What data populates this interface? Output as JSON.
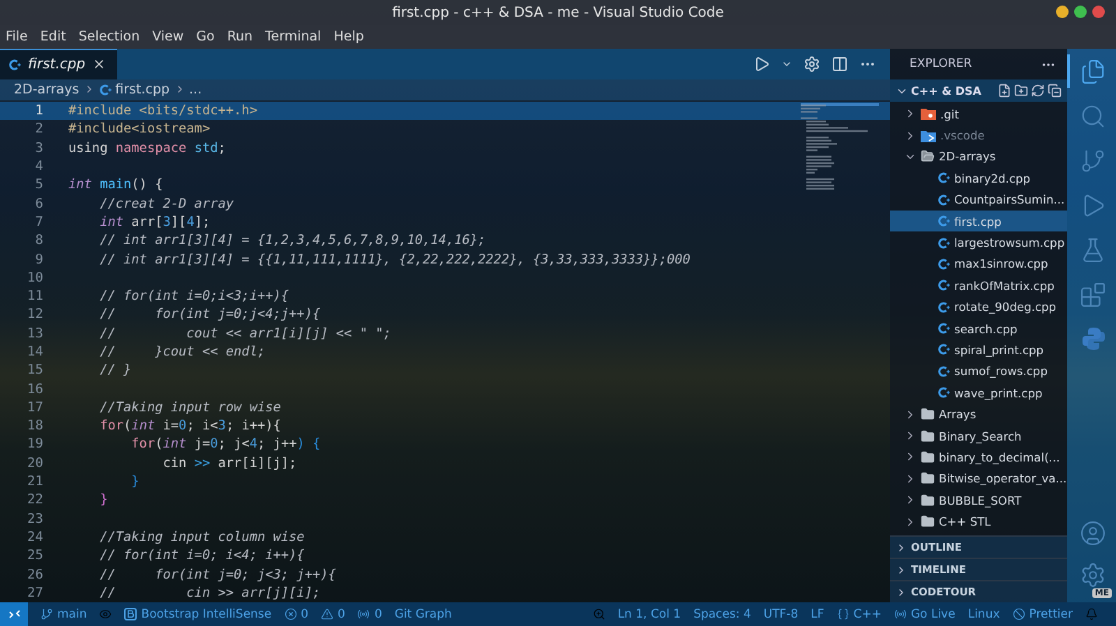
{
  "window": {
    "title": "first.cpp - c++ & DSA - me - Visual Studio Code"
  },
  "menu": [
    "File",
    "Edit",
    "Selection",
    "View",
    "Go",
    "Run",
    "Terminal",
    "Help"
  ],
  "tabs": [
    {
      "label": "first.cpp",
      "selected": true
    }
  ],
  "breadcrumbs": [
    "2D-arrays",
    "first.cpp",
    "..."
  ],
  "editor": {
    "lines": [
      {
        "number": "1",
        "current": true,
        "tokens": [
          {
            "kind": "pre",
            "t": "#include <bits/stdc++.h>"
          }
        ]
      },
      {
        "number": "2",
        "current": false,
        "tokens": [
          {
            "kind": "pre",
            "t": "#include<iostream>"
          }
        ]
      },
      {
        "number": "3",
        "current": false,
        "tokens": [
          {
            "kind": "plain",
            "t": "using "
          },
          {
            "kind": "kw",
            "t": "namespace "
          },
          {
            "kind": "ns",
            "t": "std"
          },
          {
            "kind": "plain",
            "t": ";"
          }
        ]
      },
      {
        "number": "4",
        "current": false
      },
      {
        "number": "5",
        "current": false,
        "tokens": [
          {
            "kind": "type",
            "t": "int "
          },
          {
            "kind": "fn",
            "t": "main"
          },
          {
            "kind": "plain",
            "t": "() {"
          }
        ]
      },
      {
        "number": "6",
        "current": false,
        "tokens": [
          {
            "kind": "com",
            "t": "    //creat 2-D array"
          }
        ]
      },
      {
        "number": "7",
        "current": false,
        "tokens": [
          {
            "kind": "type",
            "t": "    int"
          },
          {
            "kind": "plain",
            "t": " arr["
          },
          {
            "kind": "num",
            "t": "3"
          },
          {
            "kind": "plain",
            "t": "]["
          },
          {
            "kind": "num",
            "t": "4"
          },
          {
            "kind": "plain",
            "t": "];"
          }
        ]
      },
      {
        "number": "8",
        "current": false,
        "tokens": [
          {
            "kind": "com",
            "t": "    // int arr1[3][4] = {1,2,3,4,5,6,7,8,9,10,14,16};"
          }
        ]
      },
      {
        "number": "9",
        "current": false,
        "tokens": [
          {
            "kind": "com",
            "t": "    // int arr1[3][4] = {{1,11,111,1111}, {2,22,222,2222}, {3,33,333,3333}};000"
          }
        ]
      },
      {
        "number": "10",
        "current": false
      },
      {
        "number": "11",
        "current": false,
        "tokens": [
          {
            "kind": "com",
            "t": "    // for(int i=0;i<3;i++){"
          }
        ]
      },
      {
        "number": "12",
        "current": false,
        "tokens": [
          {
            "kind": "com",
            "t": "    //     for(int j=0;j<4;j++){"
          }
        ]
      },
      {
        "number": "13",
        "current": false,
        "tokens": [
          {
            "kind": "com",
            "t": "    //         cout << arr1[i][j] << \" \";"
          }
        ]
      },
      {
        "number": "14",
        "current": false,
        "tokens": [
          {
            "kind": "com",
            "t": "    //     }cout << endl;"
          }
        ]
      },
      {
        "number": "15",
        "current": false,
        "tokens": [
          {
            "kind": "com",
            "t": "    // }"
          }
        ]
      },
      {
        "number": "16",
        "current": false
      },
      {
        "number": "17",
        "current": false,
        "tokens": [
          {
            "kind": "com",
            "t": "    //Taking input row wise"
          }
        ]
      },
      {
        "number": "18",
        "current": false,
        "tokens": [
          {
            "kind": "kw",
            "t": "    for"
          },
          {
            "kind": "plain",
            "t": "("
          },
          {
            "kind": "type",
            "t": "int"
          },
          {
            "kind": "plain",
            "t": " i="
          },
          {
            "kind": "num",
            "t": "0"
          },
          {
            "kind": "plain",
            "t": "; i<"
          },
          {
            "kind": "num",
            "t": "3"
          },
          {
            "kind": "plain",
            "t": "; i++){"
          }
        ]
      },
      {
        "number": "19",
        "current": false,
        "tokens": [
          {
            "kind": "kw",
            "t": "        for"
          },
          {
            "kind": "plain",
            "t": "("
          },
          {
            "kind": "type",
            "t": "int"
          },
          {
            "kind": "plain",
            "t": " j="
          },
          {
            "kind": "num",
            "t": "0"
          },
          {
            "kind": "plain",
            "t": "; j<"
          },
          {
            "kind": "num",
            "t": "4"
          },
          {
            "kind": "plain",
            "t": "; j++"
          },
          {
            "kind": "brace",
            "t": ") {"
          }
        ]
      },
      {
        "number": "20",
        "current": false,
        "tokens": [
          {
            "kind": "plain",
            "t": "            cin "
          },
          {
            "kind": "op",
            "t": ">>"
          },
          {
            "kind": "plain",
            "t": " arr[i][j];"
          }
        ]
      },
      {
        "number": "21",
        "current": false,
        "tokens": [
          {
            "kind": "brace",
            "t": "        }"
          }
        ]
      },
      {
        "number": "22",
        "current": false,
        "tokens": [
          {
            "kind": "brace2",
            "t": "    }"
          }
        ]
      },
      {
        "number": "23",
        "current": false
      },
      {
        "number": "24",
        "current": false,
        "tokens": [
          {
            "kind": "com",
            "t": "    //Taking input column wise"
          }
        ]
      },
      {
        "number": "25",
        "current": false,
        "tokens": [
          {
            "kind": "com",
            "t": "    // for(int i=0; i<4; i++){"
          }
        ]
      },
      {
        "number": "26",
        "current": false,
        "tokens": [
          {
            "kind": "com",
            "t": "    //     for(int j=0; j<3; j++){"
          }
        ]
      },
      {
        "number": "27",
        "current": false,
        "tokens": [
          {
            "kind": "com",
            "t": "    //         cin >> arr[j][i];"
          }
        ]
      }
    ]
  },
  "explorer": {
    "title": "EXPLORER",
    "workspace": "C++ & DSA",
    "items": [
      {
        "name": ".git",
        "kind": "git",
        "expanded": false,
        "selected": false,
        "dimmed": false
      },
      {
        "name": ".vscode",
        "kind": "vscode",
        "expanded": false,
        "selected": false,
        "dimmed": true
      },
      {
        "name": "2D-arrays",
        "kind": "folder",
        "expanded": true,
        "selected": false,
        "dimmed": false,
        "children": [
          {
            "name": "binary2d.cpp",
            "kind": "cpp",
            "selected": false,
            "dimmed": false
          },
          {
            "name": "CountpairsSumin...",
            "kind": "cpp",
            "selected": false,
            "dimmed": false
          },
          {
            "name": "first.cpp",
            "kind": "cpp",
            "selected": true,
            "dimmed": false
          },
          {
            "name": "largestrowsum.cpp",
            "kind": "cpp",
            "selected": false,
            "dimmed": false
          },
          {
            "name": "max1sinrow.cpp",
            "kind": "cpp",
            "selected": false,
            "dimmed": false
          },
          {
            "name": "rankOfMatrix.cpp",
            "kind": "cpp",
            "selected": false,
            "dimmed": false
          },
          {
            "name": "rotate_90deg.cpp",
            "kind": "cpp",
            "selected": false,
            "dimmed": false
          },
          {
            "name": "search.cpp",
            "kind": "cpp",
            "selected": false,
            "dimmed": false
          },
          {
            "name": "spiral_print.cpp",
            "kind": "cpp",
            "selected": false,
            "dimmed": false
          },
          {
            "name": "sumof_rows.cpp",
            "kind": "cpp",
            "selected": false,
            "dimmed": false
          },
          {
            "name": "wave_print.cpp",
            "kind": "cpp",
            "selected": false,
            "dimmed": false
          }
        ]
      },
      {
        "name": "Arrays",
        "kind": "folder",
        "expanded": false,
        "selected": false,
        "dimmed": false
      },
      {
        "name": "Binary_Search",
        "kind": "folder",
        "expanded": false,
        "selected": false,
        "dimmed": false
      },
      {
        "name": "binary_to_decimal(...",
        "kind": "folder",
        "expanded": false,
        "selected": false,
        "dimmed": false
      },
      {
        "name": "Bitwise_operator_va...",
        "kind": "folder",
        "expanded": false,
        "selected": false,
        "dimmed": false
      },
      {
        "name": "BUBBLE_SORT",
        "kind": "folder",
        "expanded": false,
        "selected": false,
        "dimmed": false
      },
      {
        "name": "C++ STL",
        "kind": "folder",
        "expanded": false,
        "selected": false,
        "dimmed": false
      }
    ],
    "sections": [
      {
        "label": "OUTLINE",
        "expanded": false
      },
      {
        "label": "TIMELINE",
        "expanded": false
      },
      {
        "label": "CODETOUR",
        "expanded": false
      }
    ]
  },
  "activity_bar": {
    "items": [
      {
        "kind": "files",
        "selected": true
      },
      {
        "kind": "search",
        "selected": false
      },
      {
        "kind": "git",
        "selected": false
      },
      {
        "kind": "run",
        "selected": false
      },
      {
        "kind": "test",
        "selected": false
      },
      {
        "kind": "extensions",
        "selected": false
      },
      {
        "kind": "python",
        "selected": false
      }
    ],
    "badge": "ME"
  },
  "status_bar": {
    "left": [
      {
        "kind": "branch",
        "text": "main"
      },
      {
        "kind": "eye"
      },
      {
        "kind": "bootstrap",
        "text": "Bootstrap IntelliSense"
      },
      {
        "kind": "error",
        "text": "0"
      },
      {
        "kind": "warning",
        "text": "0"
      },
      {
        "kind": "radio",
        "text": "0"
      },
      {
        "kind": "plain",
        "text": "Git Graph"
      }
    ],
    "right": [
      {
        "kind": "zoom"
      },
      {
        "kind": "plain",
        "text": "Ln 1, Col 1"
      },
      {
        "kind": "plain",
        "text": "Spaces: 4"
      },
      {
        "kind": "plain",
        "text": "UTF-8"
      },
      {
        "kind": "plain",
        "text": "LF"
      },
      {
        "kind": "braces",
        "text": "C++"
      },
      {
        "kind": "live",
        "text": "Go Live"
      },
      {
        "kind": "plain",
        "text": "Linux"
      },
      {
        "kind": "check",
        "text": "Prettier"
      },
      {
        "kind": "bell"
      }
    ]
  }
}
